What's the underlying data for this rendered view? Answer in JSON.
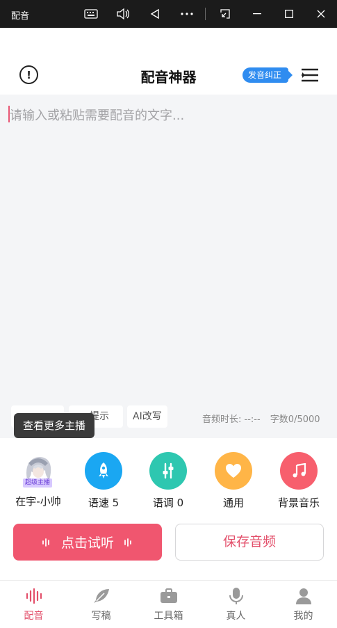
{
  "window": {
    "title": "配音"
  },
  "header": {
    "info_icon": "info-circle-icon",
    "title": "配音神器",
    "correction_badge": "发音纠正",
    "menu_icon": "menu-list-icon"
  },
  "editor": {
    "placeholder": "请输入或粘贴需要配音的文字...",
    "chips": [
      "AI改写"
    ],
    "chip_partial": "提示",
    "duration_label": "音频时长: --:--",
    "char_count": "字数0/5000"
  },
  "tooltip": {
    "text": "查看更多主播"
  },
  "tools": {
    "anchor": {
      "name": "在宇-小帅",
      "badge": "超级主播"
    },
    "speed": {
      "label": "语速 5",
      "color": "#1aa7f2"
    },
    "pitch": {
      "label": "语调 0",
      "color": "#2ec7b0"
    },
    "style": {
      "label": "通用",
      "color": "#ffb547"
    },
    "music": {
      "label": "背景音乐",
      "color": "#f75f6d"
    }
  },
  "actions": {
    "play": "点击试听",
    "save": "保存音频"
  },
  "nav": {
    "items": [
      {
        "label": "配音",
        "icon": "waveform-icon",
        "active": true
      },
      {
        "label": "写稿",
        "icon": "feather-icon",
        "active": false
      },
      {
        "label": "工具箱",
        "icon": "toolbox-icon",
        "active": false
      },
      {
        "label": "真人",
        "icon": "microphone-icon",
        "active": false
      },
      {
        "label": "我的",
        "icon": "person-icon",
        "active": false
      }
    ],
    "active_color": "#e3506b"
  }
}
